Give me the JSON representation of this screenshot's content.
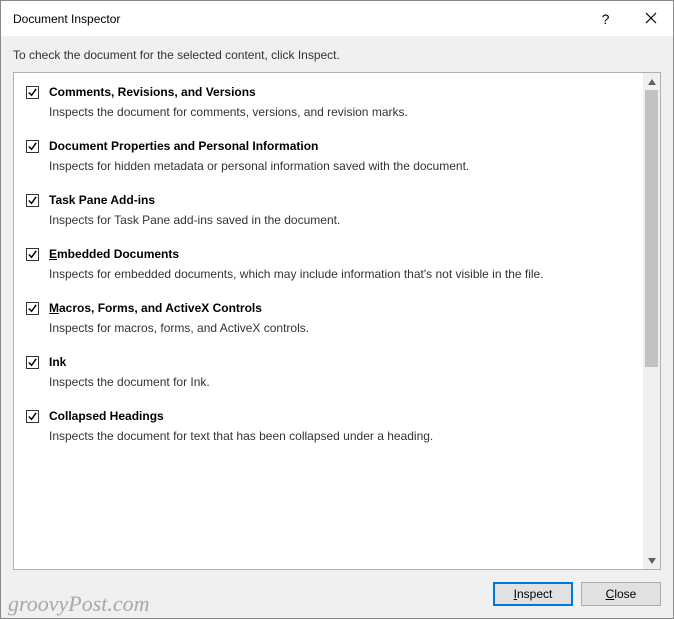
{
  "titlebar": {
    "title": "Document Inspector"
  },
  "intro": "To check the document for the selected content, click Inspect.",
  "items": [
    {
      "checked": true,
      "title": "Comments, Revisions, and Versions",
      "desc": "Inspects the document for comments, versions, and revision marks."
    },
    {
      "checked": true,
      "title": "Document Properties and Personal Information",
      "desc": "Inspects for hidden metadata or personal information saved with the document."
    },
    {
      "checked": true,
      "title": "Task Pane Add-ins",
      "desc": "Inspects for Task Pane add-ins saved in the document."
    },
    {
      "checked": true,
      "title": "Embedded Documents",
      "desc": "Inspects for embedded documents, which may include information that's not visible in the file."
    },
    {
      "checked": true,
      "title": "Macros, Forms, and ActiveX Controls",
      "desc": "Inspects for macros, forms, and ActiveX controls."
    },
    {
      "checked": true,
      "title": "Ink",
      "desc": "Inspects the document for Ink."
    },
    {
      "checked": true,
      "title": "Collapsed Headings",
      "desc": "Inspects the document for text that has been collapsed under a heading."
    }
  ],
  "buttons": {
    "inspect": "Inspect",
    "close": "Close"
  },
  "watermark": "groovyPost.com"
}
